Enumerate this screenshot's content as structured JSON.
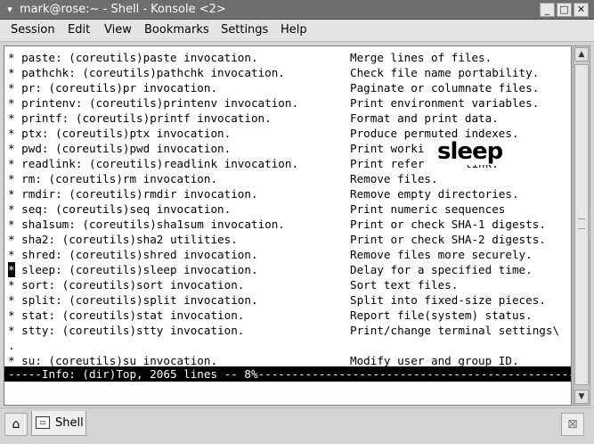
{
  "window": {
    "title": "mark@rose:~ - Shell - Konsole <2>",
    "menu_icon": "chevron-down-icon",
    "minimize_symbol": "_",
    "maximize_symbol": "□",
    "close_symbol": "✕"
  },
  "menubar": {
    "items": [
      "Session",
      "Edit",
      "View",
      "Bookmarks",
      "Settings",
      "Help"
    ]
  },
  "terminal": {
    "lines": [
      {
        "left": "* paste: (coreutils)paste invocation.",
        "right": "Merge lines of files."
      },
      {
        "left": "* pathchk: (coreutils)pathchk invocation.",
        "right": "Check file name portability."
      },
      {
        "left": "* pr: (coreutils)pr invocation.",
        "right": "Paginate or columnate files."
      },
      {
        "left": "* printenv: (coreutils)printenv invocation.",
        "right": "Print environment variables."
      },
      {
        "left": "* printf: (coreutils)printf invocation.",
        "right": "Format and print data."
      },
      {
        "left": "* ptx: (coreutils)ptx invocation.",
        "right": "Produce permuted indexes."
      },
      {
        "left": "* pwd: (coreutils)pwd invocation.",
        "right": "Print worki"
      },
      {
        "left": "* readlink: (coreutils)readlink invocation.",
        "right": "Print refer      link."
      },
      {
        "left": "* rm: (coreutils)rm invocation.",
        "right": "Remove files."
      },
      {
        "left": "* rmdir: (coreutils)rmdir invocation.",
        "right": "Remove empty directories."
      },
      {
        "left": "* seq: (coreutils)seq invocation.",
        "right": "Print numeric sequences"
      },
      {
        "left": "* sha1sum: (coreutils)sha1sum invocation.",
        "right": "Print or check SHA-1 digests."
      },
      {
        "left": "* sha2: (coreutils)sha2 utilities.",
        "right": "Print or check SHA-2 digests."
      },
      {
        "left": "* shred: (coreutils)shred invocation.",
        "right": "Remove files more securely."
      },
      {
        "left": " sleep: (coreutils)sleep invocation.",
        "right": "Delay for a specified time.",
        "cursor": "*"
      },
      {
        "left": "* sort: (coreutils)sort invocation.",
        "right": "Sort text files."
      },
      {
        "left": "* split: (coreutils)split invocation.",
        "right": "Split into fixed-size pieces."
      },
      {
        "left": "* stat: (coreutils)stat invocation.",
        "right": "Report file(system) status."
      },
      {
        "left": "* stty: (coreutils)stty invocation.",
        "right": "Print/change terminal settings\\"
      },
      {
        "left": ".",
        "right": ""
      },
      {
        "left": "* su: (coreutils)su invocation.",
        "right": "Modify user and group ID."
      }
    ],
    "status_line": "-----Info: (dir)Top, 2065 lines -- 8%------------------------------------------------------------"
  },
  "overlay": {
    "word": "sleep"
  },
  "tabbar": {
    "new_tab_icon": "new-session-icon",
    "tab_label": "Shell",
    "close_tab_icon": "close-session-icon"
  }
}
